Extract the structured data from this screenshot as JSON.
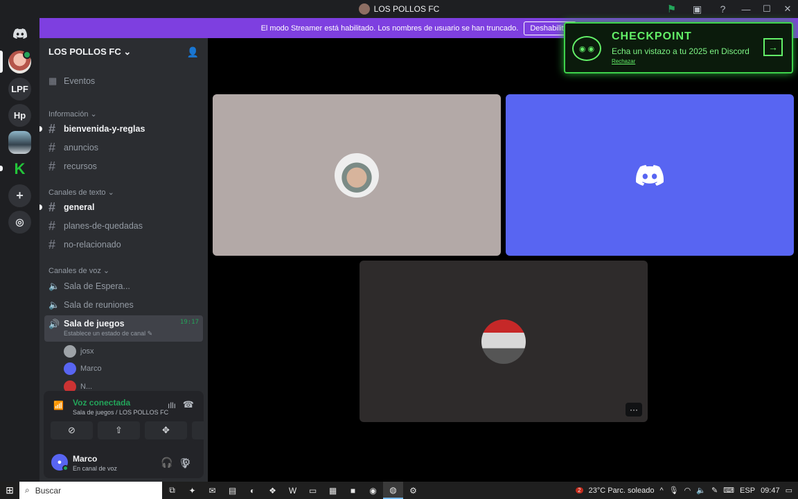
{
  "window": {
    "title": "LOS POLLOS FC"
  },
  "streamer_banner": {
    "text": "El modo Streamer está habilitado. Los nombres de usuario se han truncado.",
    "button": "Deshabilitar"
  },
  "guilds": [
    {
      "label": "LPF"
    },
    {
      "label": "Hp"
    }
  ],
  "server": {
    "name": "LOS POLLOS FC",
    "events_label": "Eventos"
  },
  "categories": {
    "info": "Información",
    "text": "Canales de texto",
    "voice": "Canales de voz"
  },
  "channels": {
    "info": [
      "bienvenida-y-reglas",
      "anuncios",
      "recursos"
    ],
    "text": [
      "general",
      "planes-de-quedadas",
      "no-relacionado"
    ],
    "voice": [
      "Sala de Espera...",
      "Sala de reuniones",
      "Sala de juegos"
    ]
  },
  "active_voice": {
    "name": "Sala de juegos",
    "time": "19:17",
    "status_prompt": "Establece un estado de canal",
    "members": [
      "josx",
      "Marco",
      "N..."
    ]
  },
  "voice_panel": {
    "status": "Voz conectada",
    "location": "Sala de juegos / LOS POLLOS FC"
  },
  "user": {
    "name": "Marco",
    "status": "En canal de voz"
  },
  "checkpoint": {
    "title": "CHECKPOINT",
    "subtitle": "Echa un vistazo a tu 2025 en Discord",
    "dismiss": "Rechazar"
  },
  "stage": {
    "more_label": "···"
  },
  "taskbar": {
    "search_placeholder": "Buscar",
    "weather": "23°C  Parc. soleado",
    "language": "ESP",
    "time": "09:47",
    "notification_count": "2"
  },
  "colors": {
    "accent": "#5865f2",
    "streamer": "#7e3fe0",
    "online": "#23a55a",
    "checkpoint": "#63f068"
  }
}
